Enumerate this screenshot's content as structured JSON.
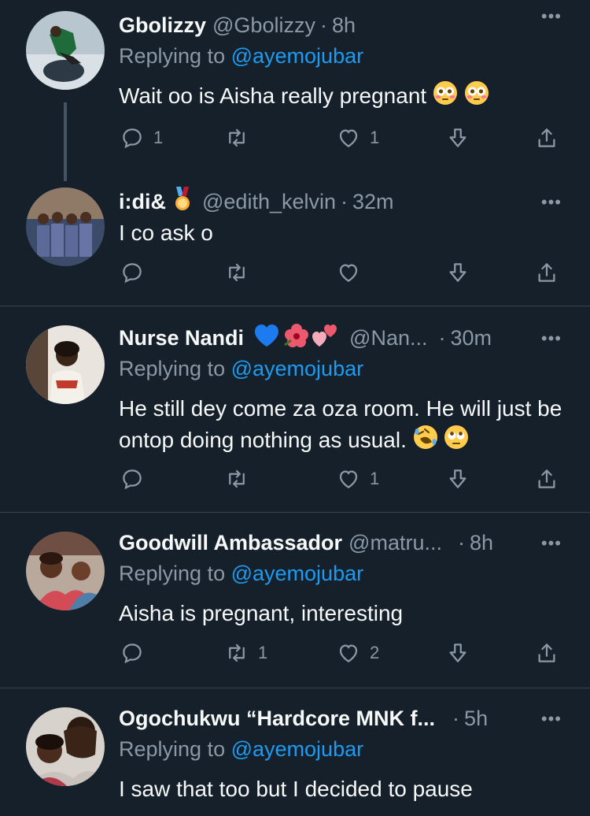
{
  "tweets": [
    {
      "name": "Gbolizzy",
      "handle": "@Gbolizzy",
      "time": "8h",
      "replying_prefix": "Replying to",
      "replying_to": "@ayemojubar",
      "text": "Wait oo is Aisha really pregnant",
      "emojis": [
        "flushed-face-emoji",
        "flushed-face-emoji"
      ],
      "counts": {
        "reply": "1",
        "retweet": "",
        "like": "1"
      }
    },
    {
      "name": "i:di&",
      "name_badge": "medal-emoji",
      "handle": "@edith_kelvin",
      "time": "32m",
      "text": "I co ask o",
      "counts": {
        "reply": "",
        "retweet": "",
        "like": ""
      }
    },
    {
      "name": "Nurse Nandi",
      "name_emojis": [
        "blue-heart-emoji",
        "hibiscus-emoji",
        "two-hearts-emoji"
      ],
      "handle": "@Nan...",
      "time": "30m",
      "replying_prefix": "Replying to",
      "replying_to": "@ayemojubar",
      "text": "He still dey come za oza room. He will just be ontop doing nothing as usual.",
      "emojis": [
        "rofl-emoji",
        "eye-roll-emoji"
      ],
      "counts": {
        "reply": "",
        "retweet": "",
        "like": "1"
      }
    },
    {
      "name": "Goodwill Ambassador",
      "handle": "@matru...",
      "time": "8h",
      "replying_prefix": "Replying to",
      "replying_to": "@ayemojubar",
      "text": "Aisha is pregnant, interesting",
      "counts": {
        "reply": "",
        "retweet": "1",
        "like": "2"
      }
    },
    {
      "name": "Ogochukwu “Hardcore MNK f...",
      "handle": "",
      "time": "5h",
      "replying_prefix": "Replying to",
      "replying_to": "@ayemojubar",
      "text": "I saw that too but I decided to pause",
      "counts": {
        "reply": "",
        "retweet": "",
        "like": ""
      }
    }
  ],
  "ui": {
    "separator": "·",
    "more_label": "•••"
  },
  "colors": {
    "background": "#15202b",
    "text": "#f7f9f9",
    "muted": "#8b98a5",
    "link": "#1d9bf0",
    "divider": "#38444d"
  }
}
